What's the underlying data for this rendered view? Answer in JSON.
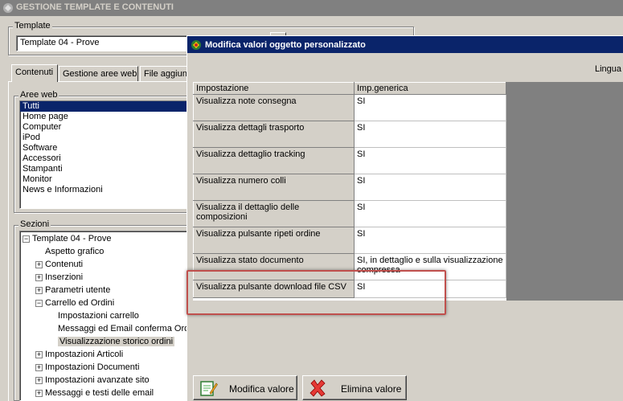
{
  "app": {
    "title": "GESTIONE TEMPLATE E CONTENUTI"
  },
  "template": {
    "label": "Template",
    "value": "Template 04 - Prove"
  },
  "tabs": [
    "Contenuti",
    "Gestione aree web",
    "File aggiun"
  ],
  "aree_web": {
    "label": "Aree web",
    "items": [
      "Tutti",
      "Home page",
      "Computer",
      "iPod",
      "Software",
      "Accessori",
      "Stampanti",
      "Monitor",
      "News e Informazioni"
    ],
    "selected_index": 0
  },
  "sezioni": {
    "label": "Sezioni",
    "tree": [
      {
        "text": "Template 04 - Prove",
        "level": 0,
        "expander": "−"
      },
      {
        "text": "Aspetto grafico",
        "level": 1,
        "expander": ""
      },
      {
        "text": "Contenuti",
        "level": 1,
        "expander": "+"
      },
      {
        "text": "Inserzioni",
        "level": 1,
        "expander": "+"
      },
      {
        "text": "Parametri utente",
        "level": 1,
        "expander": "+"
      },
      {
        "text": "Carrello ed Ordini",
        "level": 1,
        "expander": "−"
      },
      {
        "text": "Impostazioni carrello",
        "level": 2,
        "expander": ""
      },
      {
        "text": "Messaggi ed Email conferma Ordi",
        "level": 2,
        "expander": ""
      },
      {
        "text": "Visualizzazione storico ordini",
        "level": 2,
        "expander": "",
        "selected": true
      },
      {
        "text": "Impostazioni Articoli",
        "level": 1,
        "expander": "+"
      },
      {
        "text": "Impostazioni Documenti",
        "level": 1,
        "expander": "+"
      },
      {
        "text": "Impostazioni avanzate sito",
        "level": 1,
        "expander": "+"
      },
      {
        "text": "Messaggi e testi delle email",
        "level": 1,
        "expander": "+"
      }
    ]
  },
  "modal": {
    "title": "Modifica valori oggetto personalizzato",
    "lingua_label": "Lingua",
    "columns": [
      "Impostazione",
      "Imp.generica"
    ],
    "rows": [
      [
        "Visualizza note consegna",
        "SI"
      ],
      [
        "Visualizza dettagli trasporto",
        "SI"
      ],
      [
        "Visualizza dettaglio tracking",
        "SI"
      ],
      [
        "Visualizza numero colli",
        "SI"
      ],
      [
        "Visualizza il dettaglio delle composizioni",
        "SI"
      ],
      [
        "Visualizza pulsante ripeti ordine",
        "SI"
      ],
      [
        "Visualizza stato documento",
        "SI, in dettaglio e sulla visualizzazione compressa"
      ],
      [
        "Visualizza pulsante download file CSV",
        "SI"
      ]
    ],
    "buttons": {
      "modifica": "Modifica valore",
      "elimina": "Elimina valore"
    }
  },
  "colors": {
    "titlebar": "#0a246a",
    "highlight": "#c0504d",
    "face": "#d4d0c8"
  }
}
